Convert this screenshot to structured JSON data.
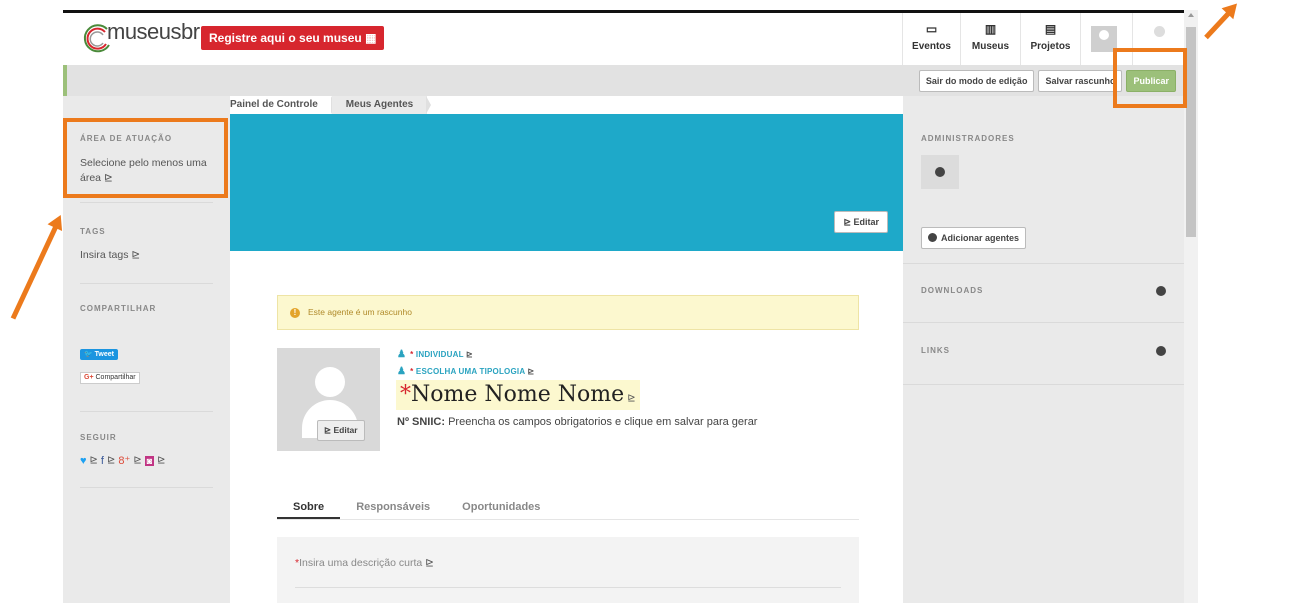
{
  "header": {
    "logo_text": "museusbr",
    "register_label": "Registre aqui o seu museu",
    "nav": [
      {
        "label": "Eventos",
        "icon": "calendar-icon"
      },
      {
        "label": "Museus",
        "icon": "building-icon"
      },
      {
        "label": "Projetos",
        "icon": "clipboard-icon"
      }
    ]
  },
  "edit_bar": {
    "exit_label": "Sair do modo de edição",
    "save_draft_label": "Salvar rascunho",
    "publish_label": "Publicar"
  },
  "breadcrumb": [
    "Painel de Controle",
    "Meus Agentes"
  ],
  "left_sidebar": {
    "area_title": "ÁREA DE ATUAÇÃO",
    "area_text": "Selecione pelo menos uma área",
    "tags_title": "TAGS",
    "tags_text": "Insira tags",
    "share_title": "COMPARTILHAR",
    "tweet_label": "Tweet",
    "gplus_label": "Compartilhar",
    "follow_title": "SEGUIR"
  },
  "banner": {
    "edit_label": "Editar"
  },
  "alert": {
    "text": "Este agente é um rascunho"
  },
  "profile": {
    "photo_edit_label": "Editar",
    "type_label": "INDIVIDUAL",
    "typology_label": "ESCOLHA UMA TIPOLOGIA",
    "name": "Nome Nome Nome",
    "sniic_label": "Nº SNIIC:",
    "sniic_text": "Preencha os campos obrigatorios e clique em salvar para gerar"
  },
  "tabs": [
    "Sobre",
    "Responsáveis",
    "Oportunidades"
  ],
  "description_placeholder": "Insira uma descrição curta",
  "right_sidebar": {
    "admins_title": "ADMINISTRADORES",
    "add_agents_label": "Adicionar agentes",
    "downloads_title": "DOWNLOADS",
    "links_title": "LINKS"
  },
  "colors": {
    "accent_blue": "#1ea9c9",
    "register_red": "#d7262e",
    "publish_green": "#9cc07a",
    "highlight_orange": "#ec7a1c"
  }
}
